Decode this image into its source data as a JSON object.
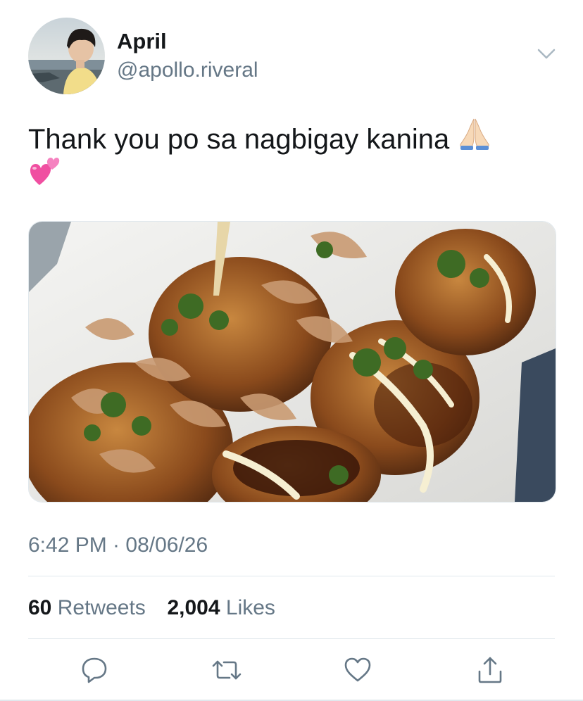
{
  "user": {
    "display_name": "April",
    "handle": "@apollo.riveral"
  },
  "tweet": {
    "text": "Thank you po sa nagbigay kanina",
    "emojis": [
      "folded-hands-emoji",
      "two-hearts-emoji"
    ]
  },
  "meta": {
    "timestamp": "6:42 PM · 08/06/26"
  },
  "stats": {
    "retweets_count": "60",
    "retweets_label": "Retweets",
    "likes_count": "2,004",
    "likes_label": "Likes"
  },
  "actions": [
    "reply-icon",
    "retweet-icon",
    "like-icon",
    "share-icon"
  ],
  "colors": {
    "primary_text": "#14171a",
    "secondary_text": "#657786",
    "divider": "#e1e8ed",
    "action_icon": "#657786"
  }
}
